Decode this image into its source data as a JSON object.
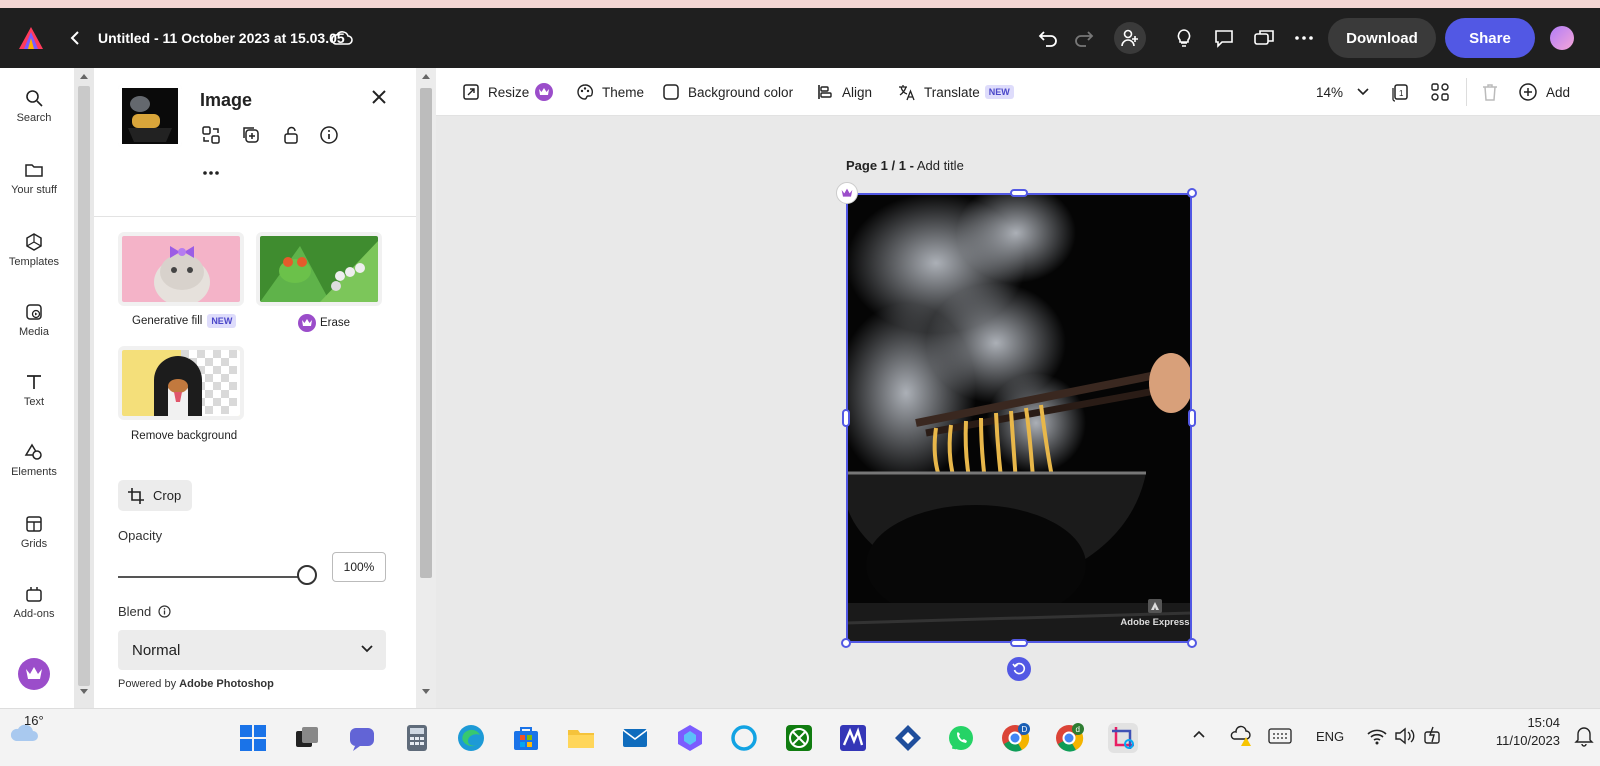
{
  "app": {
    "title": "Untitled - 11 October 2023 at 15.03.05",
    "download_label": "Download",
    "share_label": "Share"
  },
  "rail": {
    "items": [
      {
        "label": "Search"
      },
      {
        "label": "Your stuff"
      },
      {
        "label": "Templates"
      },
      {
        "label": "Media"
      },
      {
        "label": "Text"
      },
      {
        "label": "Elements"
      },
      {
        "label": "Grids"
      },
      {
        "label": "Add-ons"
      }
    ]
  },
  "panel": {
    "title": "Image",
    "tools": [
      {
        "label": "Generative fill",
        "badge": "NEW"
      },
      {
        "label": "Erase"
      },
      {
        "label": "Remove background"
      }
    ],
    "crop_label": "Crop",
    "opacity_label": "Opacity",
    "opacity_value": "100%",
    "opacity_fraction": 1.0,
    "blend_label": "Blend",
    "blend_value": "Normal",
    "powered_prefix": "Powered by",
    "powered_brand": "Adobe Photoshop"
  },
  "toolbar": {
    "resize": "Resize",
    "theme": "Theme",
    "background_color": "Background color",
    "align": "Align",
    "translate": "Translate",
    "translate_badge": "NEW",
    "zoom": "14%",
    "add": "Add"
  },
  "canvas": {
    "page_label": "Page 1 / 1 -",
    "add_title": "Add title",
    "watermark": "Adobe Express"
  },
  "taskbar": {
    "weather_temp": "16°",
    "language": "ENG",
    "time": "15:04",
    "date": "11/10/2023"
  },
  "colors": {
    "accent": "#5258e4",
    "topbar": "#1f1f1f",
    "premium": "#9b4dca"
  }
}
